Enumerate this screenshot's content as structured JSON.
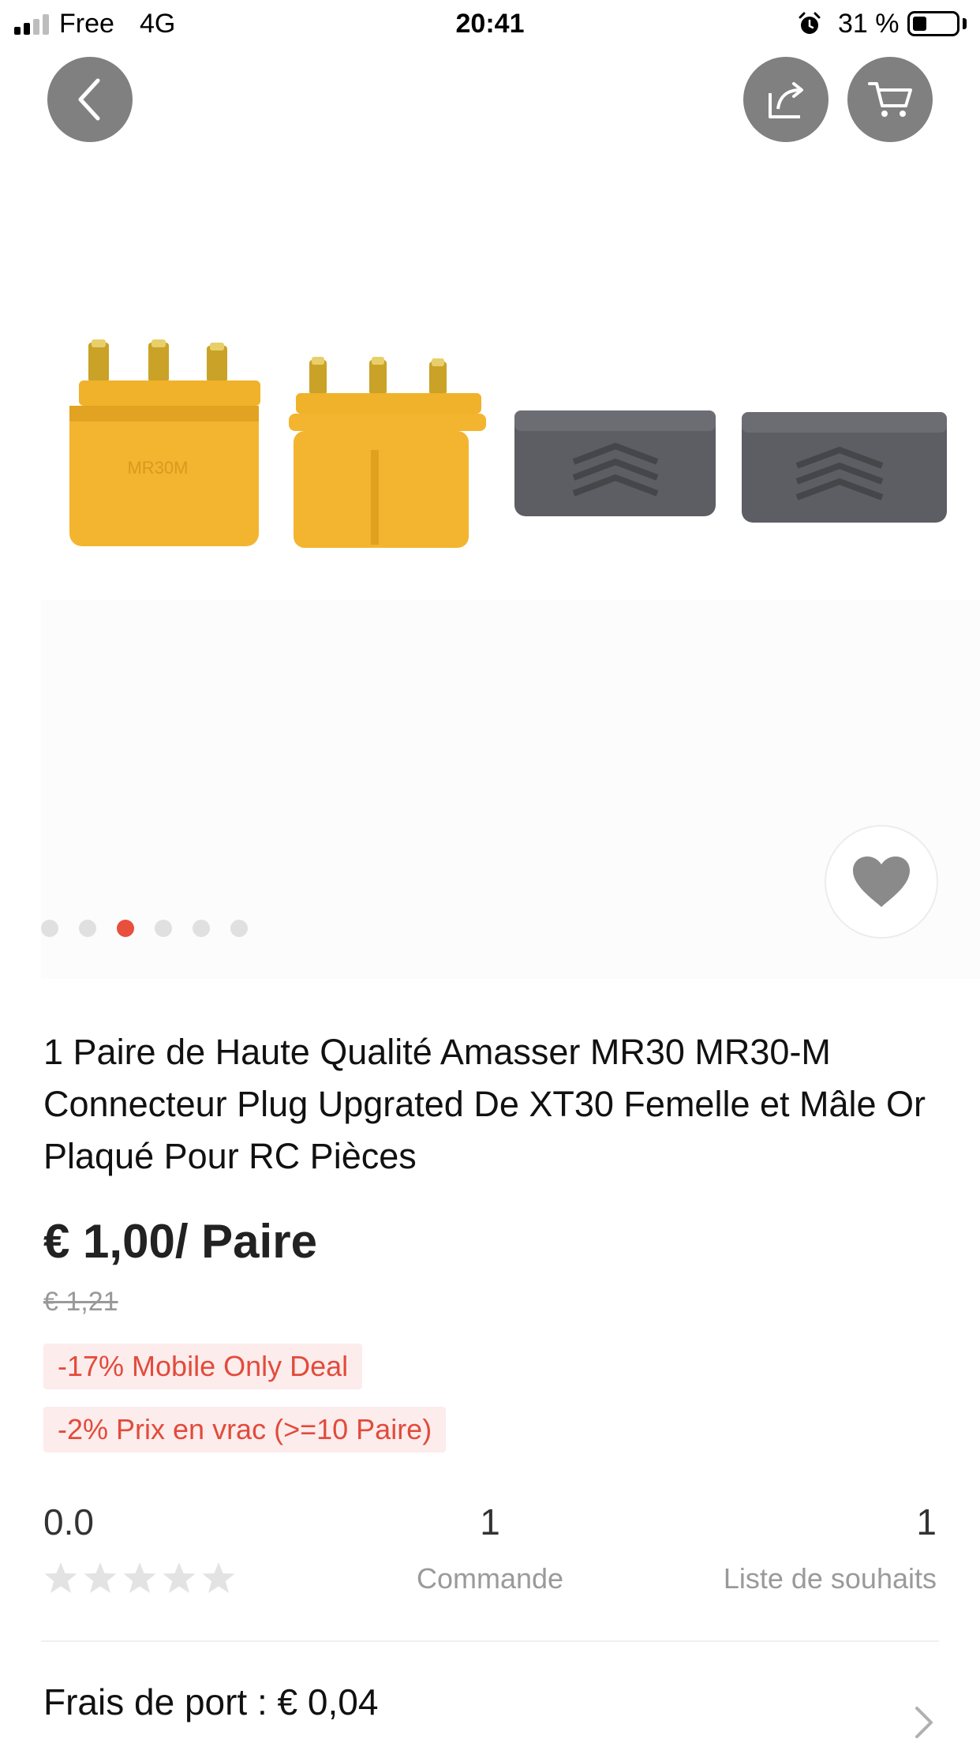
{
  "status_bar": {
    "carrier": "Free",
    "network": "4G",
    "time": "20:41",
    "battery_percent": "31 %",
    "battery_level": 0.31
  },
  "nav": {
    "back_icon": "chevron-left-icon",
    "share_icon": "share-icon",
    "cart_icon": "cart-icon"
  },
  "gallery": {
    "total_images": 6,
    "active_index": 2
  },
  "product": {
    "title": "1 Paire de Haute Qualité Amasser MR30 MR30-M Connecteur Plug Upgrated De XT30 Femelle et Mâle Or Plaqué Pour RC Pièces",
    "price": "€ 1,00/ Paire",
    "original_price": "€ 1,21",
    "promotions": [
      "-17% Mobile Only Deal",
      "-2% Prix en vrac (>=10 Paire)"
    ]
  },
  "stats": {
    "rating": "0.0",
    "stars_filled": 0,
    "stars_total": 5,
    "orders_count": "1",
    "orders_label": "Commande",
    "wishlist_count": "1",
    "wishlist_label": "Liste de souhaits"
  },
  "shipping": {
    "label": "Frais de port : € 0,04"
  },
  "colors": {
    "accent": "#e84f3d",
    "promo_bg": "#fdecec",
    "promo_text": "#e24b3b",
    "button_gray": "#808080"
  }
}
